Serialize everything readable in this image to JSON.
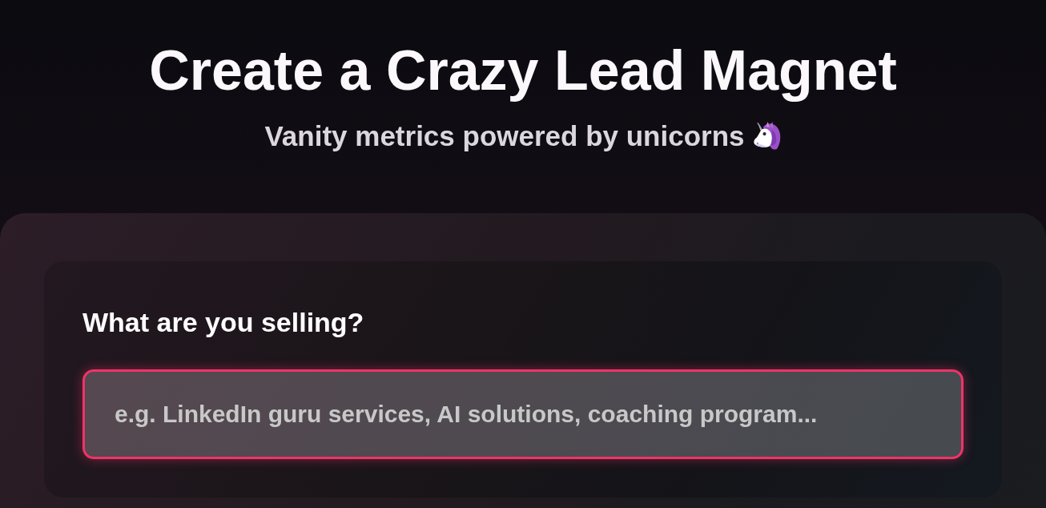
{
  "header": {
    "title": "Create a Crazy Lead Magnet",
    "subtitle": "Vanity metrics powered by unicorns"
  },
  "form": {
    "fields": [
      {
        "label": "What are you selling?",
        "placeholder": "e.g. LinkedIn guru services, AI solutions, coaching program...",
        "focused": true
      }
    ]
  }
}
